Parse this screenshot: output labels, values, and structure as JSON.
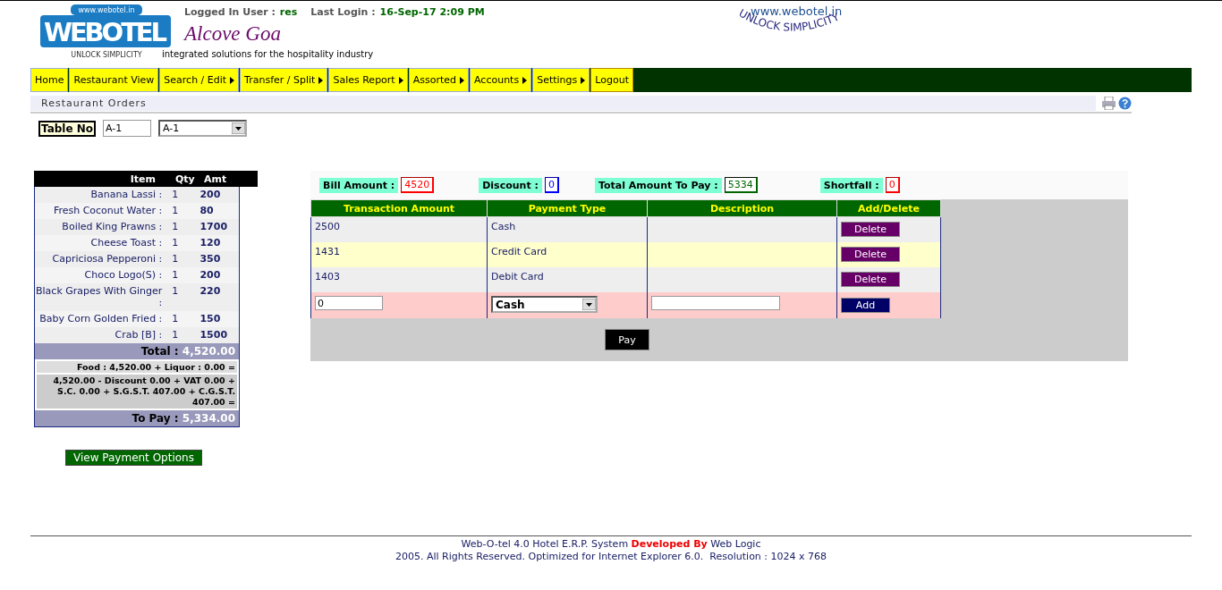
{
  "header": {
    "logo": {
      "text": "WEBOTEL",
      "url": "www.webotel.in",
      "motto": "UNLOCK SIMPLICITY"
    },
    "logged_in_label": "Logged In User :",
    "user": "res",
    "last_login_label": "Last Login :",
    "last_login": "16-Sep-17 2:09 PM",
    "hotel_name": "Alcove Goa",
    "tagline": "integrated solutions for the hospitality industry",
    "slogan": {
      "url": "www.webotel.in",
      "text": "UNLOCK SIMPLICITY"
    }
  },
  "menu": [
    {
      "label": "Home",
      "kind": "link",
      "selected": false
    },
    {
      "label": "Restaurant View",
      "kind": "link",
      "selected": false
    },
    {
      "label": "Search / Edit",
      "kind": "submenu",
      "selected": false
    },
    {
      "label": "Transfer / Split",
      "kind": "submenu",
      "selected": false
    },
    {
      "label": "Sales Report",
      "kind": "submenu",
      "selected": false
    },
    {
      "label": "Assorted",
      "kind": "submenu",
      "selected": false
    },
    {
      "label": "Accounts",
      "kind": "submenu",
      "selected": false
    },
    {
      "label": "Settings",
      "kind": "submenu",
      "selected": false
    },
    {
      "label": "Logout",
      "kind": "link",
      "selected": true
    }
  ],
  "page_title": "Restaurant Orders",
  "table_no": {
    "label": "Table No",
    "value": "A-1",
    "select": "A-1"
  },
  "order": {
    "columns": [
      "Item",
      "Qty",
      "Amt"
    ],
    "items": [
      {
        "name": "Banana Lassi :",
        "qty": "1",
        "amt": "200"
      },
      {
        "name": "Fresh Coconut Water :",
        "qty": "1",
        "amt": "80"
      },
      {
        "name": "Boiled King Prawns :",
        "qty": "1",
        "amt": "1700"
      },
      {
        "name": "Cheese Toast :",
        "qty": "1",
        "amt": "120"
      },
      {
        "name": "Capriciosa Pepperoni :",
        "qty": "1",
        "amt": "350"
      },
      {
        "name": "Choco Logo(S) :",
        "qty": "1",
        "amt": "200"
      },
      {
        "name": "Black Grapes With Ginger :",
        "qty": "1",
        "amt": "220"
      },
      {
        "name": "Baby Corn Golden Fried :",
        "qty": "1",
        "amt": "150"
      },
      {
        "name": "Crab [B] :",
        "qty": "1",
        "amt": "1500"
      }
    ],
    "total_label": "Total :",
    "total": "4,520.00",
    "breakdown": "Food : 4,520.00   +   Liquor : 0.00 =",
    "calculation": "4,520.00 - Discount 0.00 + VAT 0.00 + S.C. 0.00 + S.G.S.T. 407.00 + C.G.S.T. 407.00 =",
    "to_pay_label": "To Pay :",
    "to_pay": "5,334.00",
    "button": "View Payment Options"
  },
  "summary": [
    {
      "label": "Bill Amount :",
      "value": "4520",
      "color": "#ff0000"
    },
    {
      "label": "Discount :",
      "value": "0",
      "color": "#0000ff"
    },
    {
      "label": "Total Amount To Pay :",
      "value": "5334",
      "color": "#006600"
    },
    {
      "label": "Shortfall :",
      "value": "0",
      "color": "#ff0000"
    }
  ],
  "payments": {
    "columns": [
      "Transaction Amount",
      "Payment Type",
      "Description",
      "Add/Delete"
    ],
    "rows": [
      {
        "amount": "2500",
        "type": "Cash",
        "action": "Delete"
      },
      {
        "amount": "1431",
        "type": "Credit Card",
        "action": "Delete"
      },
      {
        "amount": "1403",
        "type": "Debit Card",
        "action": "Delete"
      }
    ],
    "new_row": {
      "amount": "0",
      "type": "Cash",
      "button": "Add"
    },
    "pay_button": "Pay"
  },
  "footer": [
    "Web-O-tel 4.0 Hotel E.R.P. System **Developed By** Web Logic",
    "2005. All Rights Reserved. Optimized for Internet Explorer 6.0.  Resolution : 1024 x 768"
  ]
}
